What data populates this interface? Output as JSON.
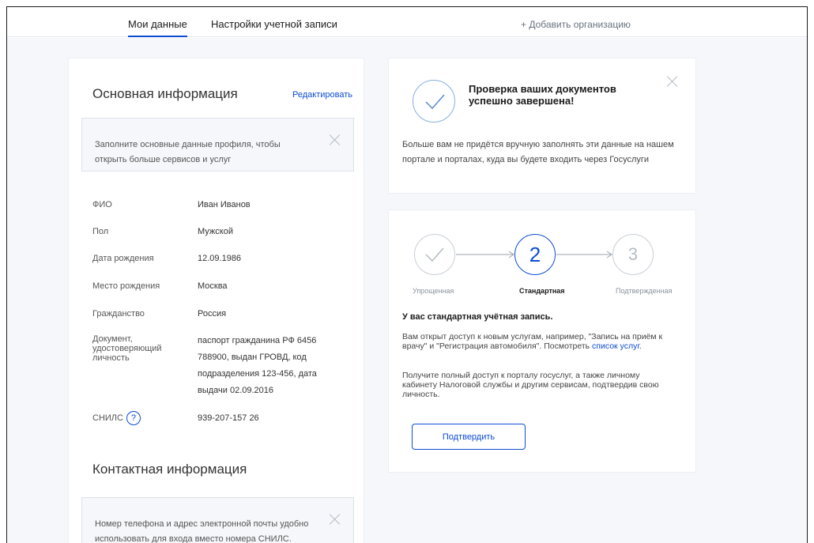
{
  "nav": {
    "tab_mine": "Мои данные",
    "tab_settings": "Настройки учетной записи",
    "add_org": "+ Добавить организацию"
  },
  "basic": {
    "title": "Основная информация",
    "edit": "Редактировать",
    "notice": "Заполните основные данные профиля, чтобы открыть больше сервисов и услуг",
    "fields": [
      {
        "label": "ФИО",
        "value": "Иван Иванов"
      },
      {
        "label": "Пол",
        "value": "Мужской"
      },
      {
        "label": "Дата рождения",
        "value": "12.09.1986"
      },
      {
        "label": "Место рождения",
        "value": "Москва"
      },
      {
        "label": "Гражданство",
        "value": "Россия"
      },
      {
        "label": "Документ, удостоверяющий личность",
        "value": "паспорт гражданина РФ 6456 788900, выдан ГРОВД, код подразделения 123-456, дата выдачи 02.09.2016"
      },
      {
        "label": "СНИЛС",
        "value": "939-207-157 26"
      }
    ]
  },
  "contact": {
    "title": "Контактная информация",
    "notice": "Номер телефона и адрес электронной почты удобно использовать для входа вместо номера СНИЛС."
  },
  "verify": {
    "title": "Проверка ваших документов успешно завершена!",
    "text": "Больше вам не придётся вручную заполнять эти данные на нашем портале и порталах, куда вы будете входить через Госуслуги"
  },
  "account": {
    "steps": [
      {
        "number": "",
        "label": "Упрощенная"
      },
      {
        "number": "2",
        "label": "Стандартная"
      },
      {
        "number": "3",
        "label": "Подтвержденная"
      }
    ],
    "title": "У вас стандартная учётная запись.",
    "text1": "Вам открыт доступ к новым услугам, например, \"Запись на приём к врачу\" и \"Регистрация автомобиля\". Посмотреть",
    "link": "список услуг",
    "text2": "Получите полный доступ к порталу госуслуг, а также личному кабинету Налоговой службы и другим сервисам, подтвердив свою личность.",
    "confirm": "Подтвердить"
  },
  "colors": {
    "accent": "#0d4cd3",
    "background": "#f5f7fa"
  }
}
